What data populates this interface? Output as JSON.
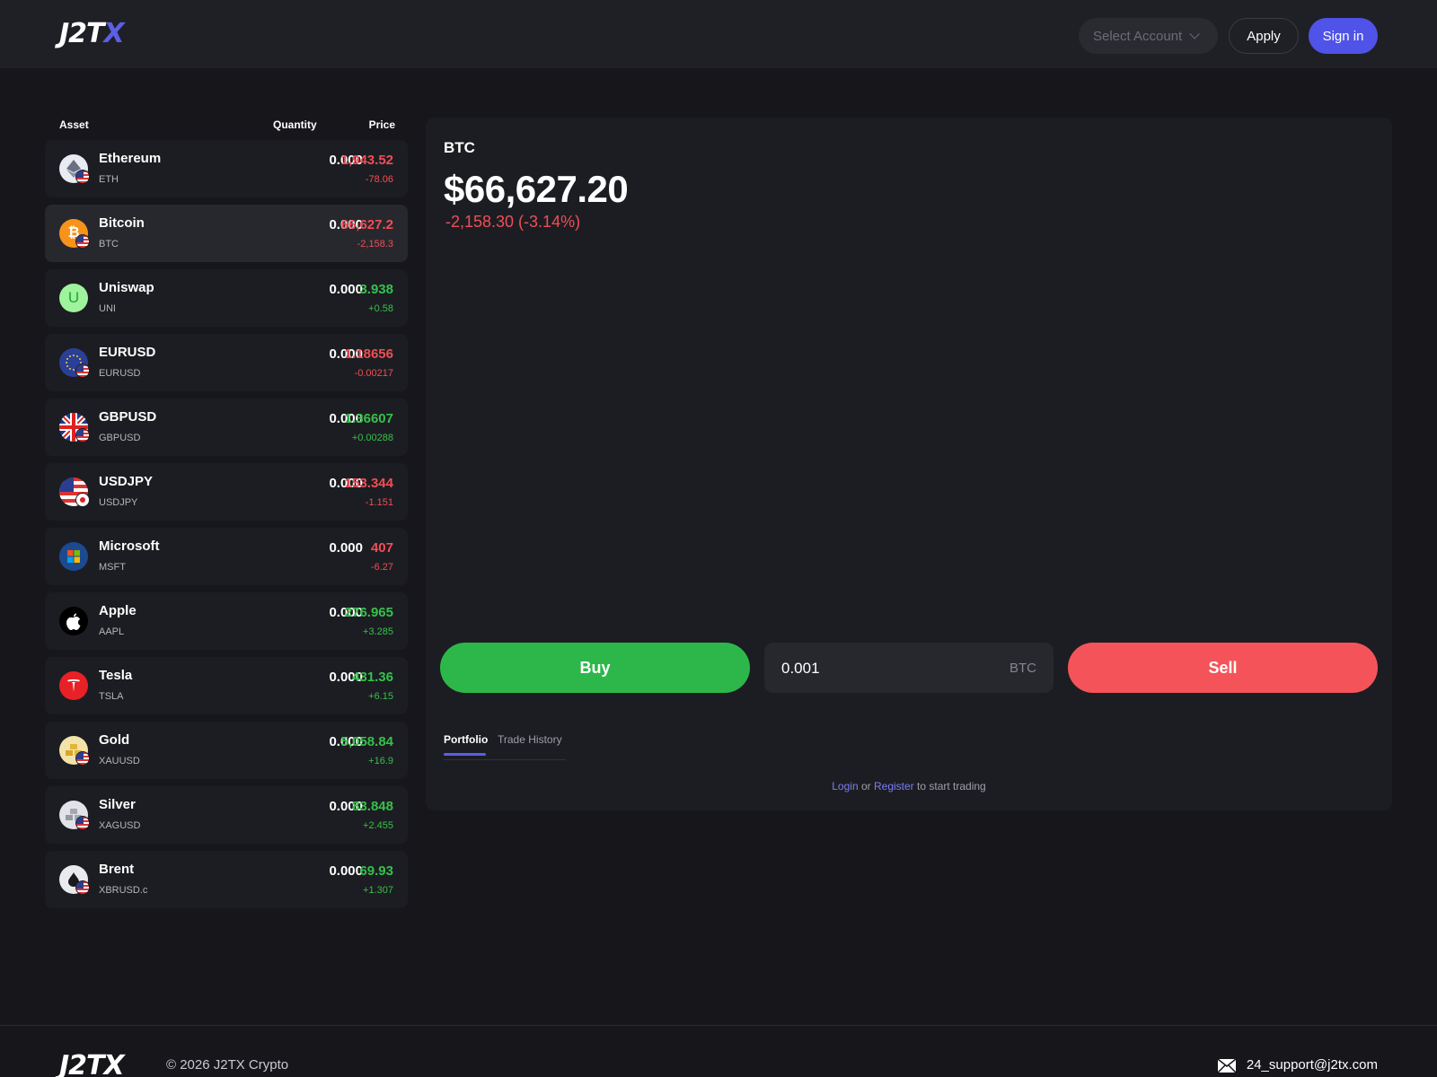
{
  "header": {
    "logo_main": "J2T",
    "logo_accent": "X",
    "select_account": "Select Account",
    "apply_label": "Apply",
    "signin_label": "Sign in"
  },
  "asset_table": {
    "col_asset": "Asset",
    "col_quantity": "Quantity",
    "col_price": "Price",
    "rows": [
      {
        "name": "Ethereum",
        "symbol": "ETH",
        "quantity": "0.000",
        "price": "1,943.52",
        "change": "-78.06",
        "direction": "down",
        "icon": "ethereum-icon",
        "flag": "us-flag-icon",
        "selected": false
      },
      {
        "name": "Bitcoin",
        "symbol": "BTC",
        "quantity": "0.000",
        "price": "66,627.2",
        "change": "-2,158.3",
        "direction": "down",
        "icon": "bitcoin-icon",
        "flag": "us-flag-icon",
        "selected": true
      },
      {
        "name": "Uniswap",
        "symbol": "UNI",
        "quantity": "0.000",
        "price": "3.938",
        "change": "+0.58",
        "direction": "up",
        "icon": "uniswap-icon",
        "flag": "",
        "selected": false
      },
      {
        "name": "EURUSD",
        "symbol": "EURUSD",
        "quantity": "0.000",
        "price": "1.18656",
        "change": "-0.00217",
        "direction": "down",
        "icon": "eu-flag-icon",
        "flag": "us-flag-icon",
        "selected": false
      },
      {
        "name": "GBPUSD",
        "symbol": "GBPUSD",
        "quantity": "0.000",
        "price": "1.36607",
        "change": "+0.00288",
        "direction": "up",
        "icon": "uk-flag-icon",
        "flag": "us-flag-icon",
        "selected": false
      },
      {
        "name": "USDJPY",
        "symbol": "USDJPY",
        "quantity": "0.000",
        "price": "153.344",
        "change": "-1.151",
        "direction": "down",
        "icon": "us-flag-icon",
        "flag": "jp-flag-icon",
        "selected": false
      },
      {
        "name": "Microsoft",
        "symbol": "MSFT",
        "quantity": "0.000",
        "price": "407",
        "change": "-6.27",
        "direction": "down",
        "icon": "microsoft-icon",
        "flag": "",
        "selected": false
      },
      {
        "name": "Apple",
        "symbol": "AAPL",
        "quantity": "0.000",
        "price": "276.965",
        "change": "+3.285",
        "direction": "up",
        "icon": "apple-icon",
        "flag": "",
        "selected": false
      },
      {
        "name": "Tesla",
        "symbol": "TSLA",
        "quantity": "0.000",
        "price": "431.36",
        "change": "+6.15",
        "direction": "up",
        "icon": "tesla-icon",
        "flag": "",
        "selected": false
      },
      {
        "name": "Gold",
        "symbol": "XAUUSD",
        "quantity": "0.000",
        "price": "5,058.84",
        "change": "+16.9",
        "direction": "up",
        "icon": "gold-icon",
        "flag": "us-flag-icon",
        "selected": false
      },
      {
        "name": "Silver",
        "symbol": "XAGUSD",
        "quantity": "0.000",
        "price": "83.848",
        "change": "+2.455",
        "direction": "up",
        "icon": "silver-icon",
        "flag": "us-flag-icon",
        "selected": false
      },
      {
        "name": "Brent",
        "symbol": "XBRUSD.c",
        "quantity": "0.000",
        "price": "69.93",
        "change": "+1.307",
        "direction": "up",
        "icon": "oil-drop-icon",
        "flag": "us-flag-icon",
        "selected": false
      }
    ]
  },
  "panel": {
    "symbol": "BTC",
    "price": "$66,627.20",
    "change": "-2,158.30 (-3.14%)",
    "buy_label": "Buy",
    "sell_label": "Sell",
    "amount_value": "0.001",
    "amount_unit": "BTC",
    "tabs": [
      {
        "label": "Portfolio",
        "active": true
      },
      {
        "label": "Trade History",
        "active": false
      }
    ],
    "login_link": "Login",
    "login_or": "or",
    "register_link": "Register",
    "login_suffix": "to start trading"
  },
  "footer": {
    "logo": "J2TX",
    "copyright": "© 2026 J2TX Crypto",
    "email": "24_support@j2tx.com"
  },
  "colors": {
    "accent": "#5053e8",
    "up": "#35c14a",
    "down": "#f04e55",
    "buy": "#2db74a",
    "sell": "#f45459"
  }
}
